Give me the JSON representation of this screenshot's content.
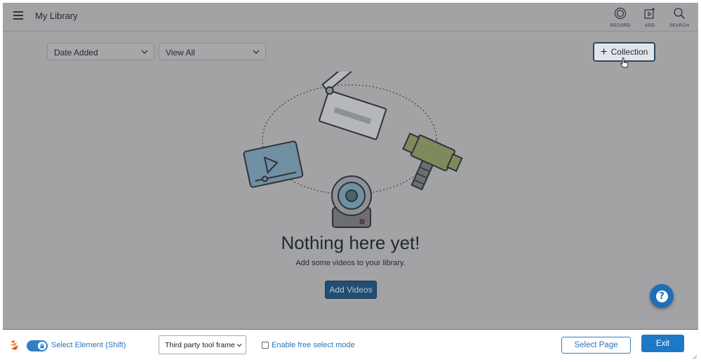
{
  "app": {
    "title": "My Library",
    "actions": [
      {
        "label": "RECORD",
        "icon": "record-icon"
      },
      {
        "label": "ADD",
        "icon": "add-video-icon"
      },
      {
        "label": "SEARCH",
        "icon": "search-icon"
      }
    ]
  },
  "filters": {
    "sort_value": "Date Added",
    "view_value": "View All"
  },
  "collection_button": {
    "label": "Collection"
  },
  "empty_state": {
    "title": "Nothing here yet!",
    "subtitle": "Add some videos to your library.",
    "button": "Add Videos"
  },
  "picker": {
    "toggle_label": "Select Element (Shift)",
    "frame_select_value": "Third party tool frame",
    "free_select_label": "Enable free select mode",
    "select_page_label": "Select Page",
    "exit_label": "Exit"
  },
  "colors": {
    "overlay": "#a3a3a5",
    "primary_blue": "#1d78c5",
    "add_videos_bg": "#234d72"
  }
}
